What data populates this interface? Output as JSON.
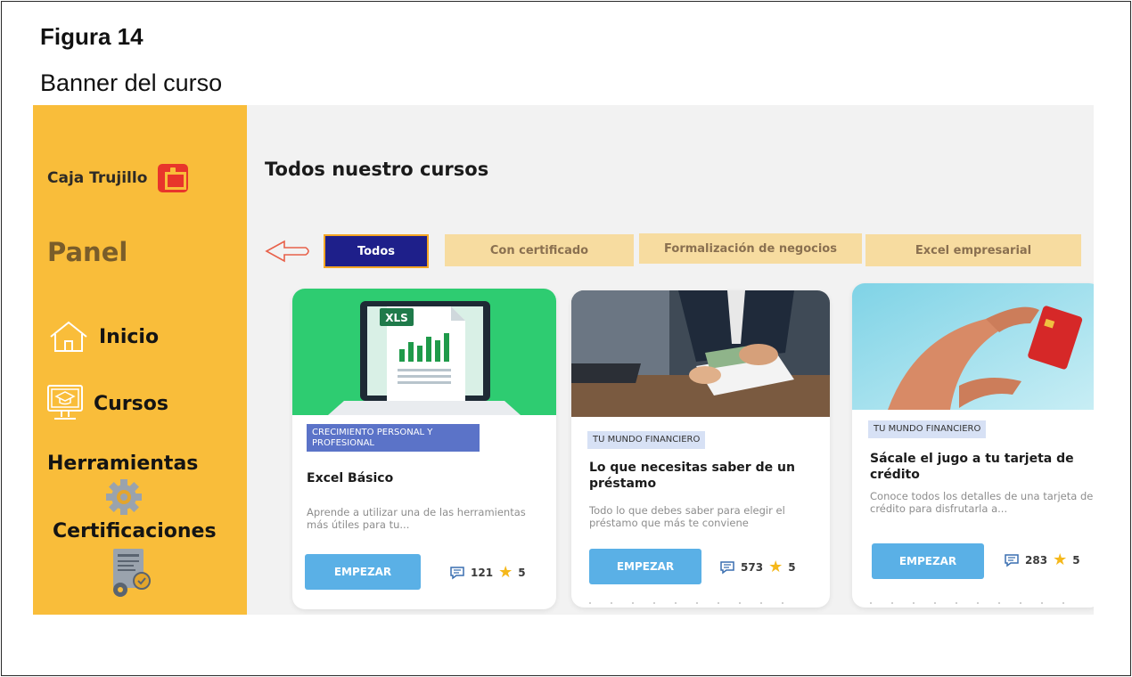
{
  "figure": {
    "label": "Figura 14",
    "caption": "Banner del curso"
  },
  "sidebar": {
    "brand": "Caja Trujillo",
    "panel_title": "Panel",
    "items": [
      {
        "label": "Inicio",
        "icon": "home-icon"
      },
      {
        "label": "Cursos",
        "icon": "course-monitor-icon"
      },
      {
        "label": "Herramientas",
        "icon": "gear-icon"
      },
      {
        "label": "Certificaciones",
        "icon": "certificate-icon"
      }
    ]
  },
  "main": {
    "title": "Todos nuestro cursos",
    "tabs": [
      {
        "label": "Todos",
        "active": true
      },
      {
        "label": "Con certificado",
        "active": false
      },
      {
        "label": "Formalización de negocios",
        "active": false
      },
      {
        "label": "Excel empresarial",
        "active": false
      }
    ],
    "cards": [
      {
        "tag": "CRECIMIENTO PERSONAL Y PROFESIONAL",
        "title": "Excel Básico",
        "description": "Aprende a utilizar una de las herramientas más útiles para tu...",
        "button": "EMPEZAR",
        "comments": "121",
        "rating": "5",
        "image": "excel-laptop-illustration",
        "image_badge": "XLS"
      },
      {
        "tag": "TU MUNDO FINANCIERO",
        "title": "Lo que necesitas saber de un préstamo",
        "description": "Todo lo que debes saber para elegir el préstamo que más te conviene",
        "button": "EMPEZAR",
        "comments": "573",
        "rating": "5",
        "image": "loan-handshake-photo"
      },
      {
        "tag": "TU MUNDO FINANCIERO",
        "title": "Sácale el jugo a tu tarjeta de crédito",
        "description": "Conoce todos los detalles de una tarjeta de crédito para disfrutarla a...",
        "button": "EMPEZAR",
        "comments": "283",
        "rating": "5",
        "image": "hand-credit-card-photo"
      }
    ]
  },
  "colors": {
    "sidebar_bg": "#f9bd3a",
    "active_tab": "#1e1f8a",
    "tab_bg": "#f7dca0",
    "button": "#5ab0e6",
    "tag_primary": "#5b73c8",
    "tag_light": "#d7e1f5",
    "excel_green": "#2ecc71"
  }
}
